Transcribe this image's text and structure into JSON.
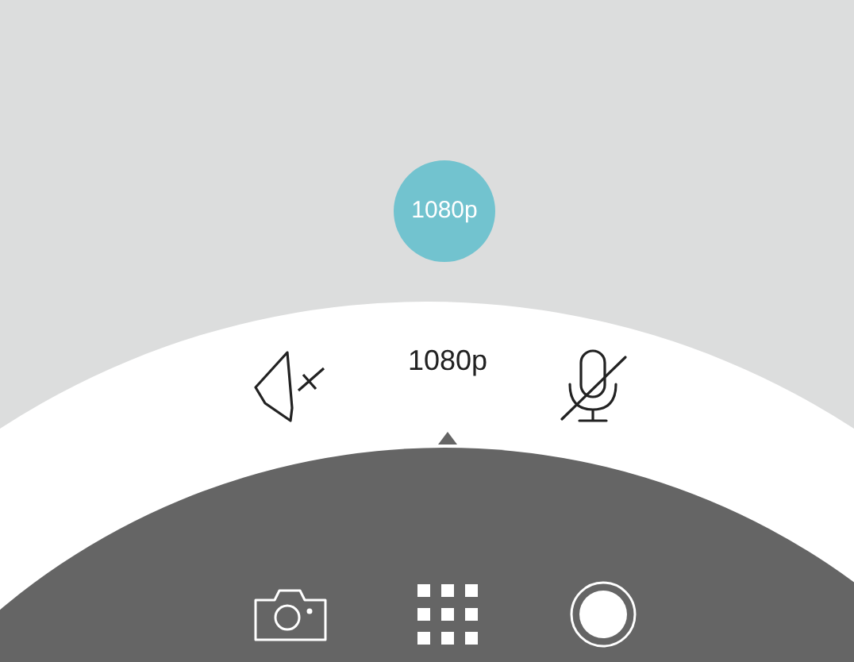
{
  "resolution_badge": "1080p",
  "quality_menu": {
    "label": "1080p",
    "sound_muted": true,
    "mic_muted": true
  },
  "toolbar": [
    {
      "kind": "camera"
    },
    {
      "kind": "grid"
    },
    {
      "kind": "record"
    }
  ]
}
